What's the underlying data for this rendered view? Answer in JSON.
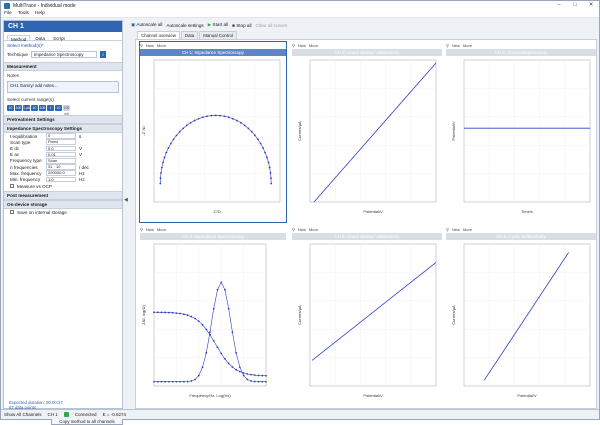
{
  "window": {
    "title": "MultiTrace - Individual mode",
    "menu": [
      "File",
      "Tools",
      "Help"
    ]
  },
  "left": {
    "channel": "CH 1",
    "tabs": [
      "Method",
      "Data",
      "Script"
    ],
    "method_section": "Select method(s)*",
    "technique_label": "Technique",
    "technique_value": "Impedance Spectroscopy",
    "measurement": "Measurement",
    "notes_label": "Notes",
    "notes_value": "CH1 Gamry/ add notes...",
    "ranges_label": "Select current range(s)",
    "ranges": [
      "10 nA",
      "100 nA",
      "1 µA",
      "10 µA",
      "100 µA",
      "1 mA",
      "10 mA",
      "100 mA"
    ],
    "groups": {
      "pre": "Pretreatment Settings",
      "eis": "Impedance Spectroscopy Settings",
      "post": "Post measurement",
      "store": "On-device storage"
    },
    "props": [
      {
        "k": "t equilibration",
        "v": "0",
        "u": "s"
      },
      {
        "k": "Scan type",
        "v": "Fixed",
        "u": ""
      },
      {
        "k": "E dc",
        "v": "0.0",
        "u": "V"
      },
      {
        "k": "E ac",
        "v": "0.01",
        "u": "V"
      },
      {
        "k": "Frequency type",
        "v": "Scan",
        "u": ""
      },
      {
        "k": "n frequencies",
        "v": "31 · 10",
        "u": "/ dec"
      },
      {
        "k": "Max. frequency",
        "v": "200000.0",
        "u": "Hz"
      },
      {
        "k": "Min. frequency",
        "v": "1.0",
        "u": "Hz"
      }
    ],
    "ocp_label": "Measure vs OCP",
    "store_label": "Save on internal storage",
    "info": [
      "Expected duration: 00:00:27",
      "87 data points"
    ],
    "copy_button": "Copy method to all channels"
  },
  "toolbar": {
    "autoscale": "Autoscale all",
    "autoscale_settings": "Autoscale settings",
    "start": "Start all",
    "stop": "Stop all",
    "clear": "Clear all curves"
  },
  "main_tabs": [
    "Channel overview",
    "Data",
    "Manual Control"
  ],
  "panels": [
    {
      "title": "CH 1: Impedance Spectroscopy",
      "active": true,
      "xlabel": "Z'/Ω",
      "ylabel": "-Z''/Ω"
    },
    {
      "title": "CH 2: Linear Sweep Voltammetry",
      "active": false,
      "xlabel": "Potential/V",
      "ylabel": "Current/µA"
    },
    {
      "title": "CH 3: Chronoamperometry",
      "active": false,
      "xlabel": "Time/s",
      "ylabel": "Potential/V"
    },
    {
      "title": "CH 4: Impedance Spectroscopy",
      "active": false,
      "xlabel": "Frequency/Hz, Log(Hz)",
      "ylabel": "Z/Ω, log(Ω)"
    },
    {
      "title": "CH 5: Linear Sweep Voltammetry",
      "active": false,
      "xlabel": "Potential/V",
      "ylabel": "Current/µA"
    },
    {
      "title": "CH 6: Cyclic Voltammetry",
      "active": false,
      "xlabel": "Potential/V",
      "ylabel": "Current/µA"
    }
  ],
  "panel_toolbar": {
    "new": "New",
    "more": "More"
  },
  "status": {
    "show": "Show All Channels",
    "channel": "CH 1",
    "connected": "Connected",
    "readout": "E = -0.6274"
  }
}
